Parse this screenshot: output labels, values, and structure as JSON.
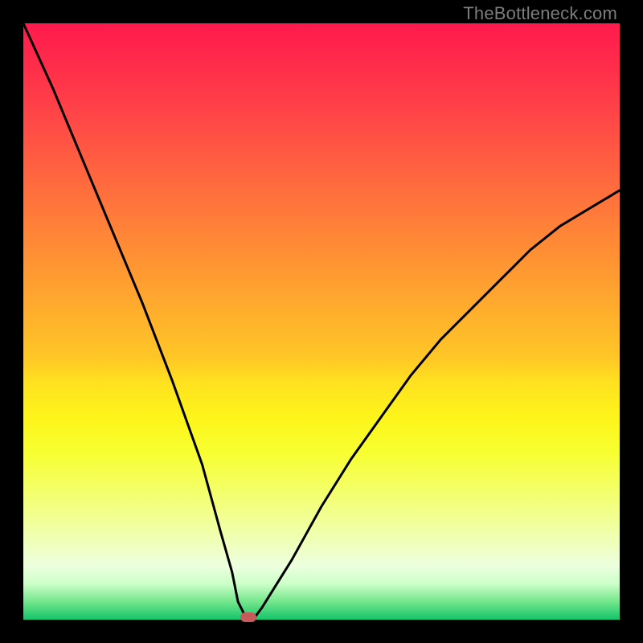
{
  "watermark": "TheBottleneck.com",
  "colors": {
    "frame_bg": "#000000",
    "marker": "#c75a5a",
    "curve": "#000000"
  },
  "chart_data": {
    "type": "line",
    "title": "",
    "xlabel": "",
    "ylabel": "",
    "xlim": [
      0,
      100
    ],
    "ylim": [
      0,
      100
    ],
    "grid": false,
    "series": [
      {
        "name": "bottleneck-curve",
        "x": [
          0,
          5,
          10,
          15,
          20,
          25,
          30,
          33,
          35,
          36,
          37.5,
          38.5,
          40,
          45,
          50,
          55,
          60,
          65,
          70,
          75,
          80,
          85,
          90,
          95,
          100
        ],
        "y": [
          100,
          89,
          77,
          65,
          53,
          40,
          26,
          15,
          8,
          3,
          0,
          0,
          2,
          10,
          19,
          27,
          34,
          41,
          47,
          52,
          57,
          62,
          66,
          69,
          72
        ]
      }
    ],
    "marker": {
      "x": 37.8,
      "y": 0
    },
    "note": "Values estimated from pixels; axes have no ticks or labels."
  }
}
